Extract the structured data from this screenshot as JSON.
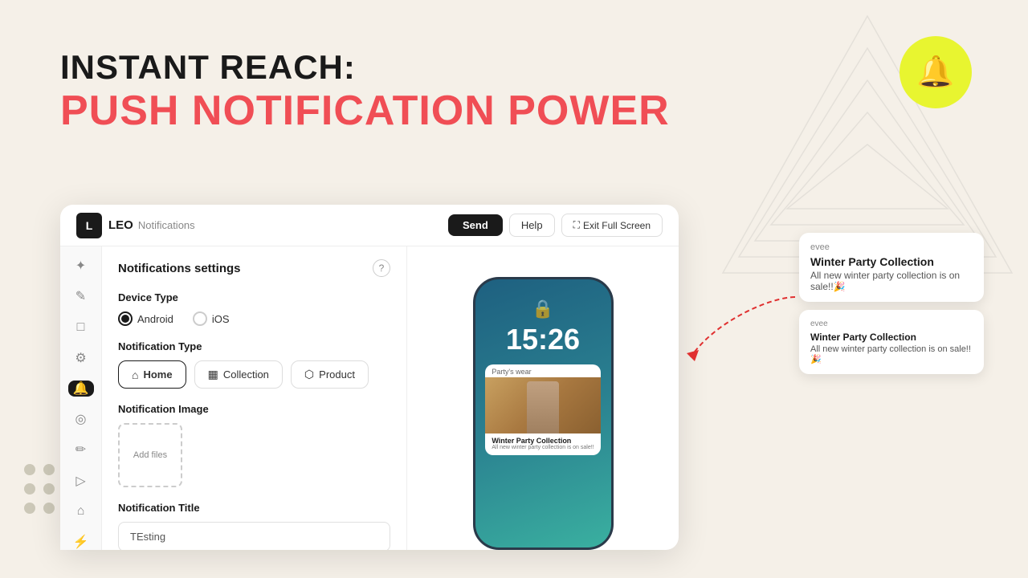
{
  "page": {
    "background_color": "#f5f0e8",
    "header": {
      "line1": "INSTANT REACH:",
      "line2": "PUSH NOTIFICATION POWER"
    },
    "bell_icon": "🔔"
  },
  "app": {
    "logo_text": "L",
    "name": "LEO",
    "subtitle": "Notifications",
    "buttons": {
      "send": "Send",
      "help": "Help",
      "exit": "Exit Full Screen"
    },
    "sidebar_icons": [
      "✦",
      "✎",
      "□",
      "⚙",
      "🔔",
      "◎",
      "✏",
      "▷",
      "⌂",
      "⚡"
    ],
    "settings": {
      "title": "Notifications settings",
      "device_type_label": "Device Type",
      "device_options": [
        "Android",
        "iOS"
      ],
      "device_selected": "Android",
      "notification_type_label": "Notification Type",
      "notification_types": [
        {
          "label": "Home",
          "active": true
        },
        {
          "label": "Collection",
          "active": false
        },
        {
          "label": "Product",
          "active": false
        }
      ],
      "image_label": "Notification Image",
      "add_files_label": "Add files",
      "title_label": "Notification Title",
      "title_value": "TEsting"
    }
  },
  "phone": {
    "time": "15:26",
    "card_label": "Party's wear",
    "card_title": "Winter Party Collection",
    "card_desc": "All new winter party collection is on sale!!"
  },
  "notifications": [
    {
      "app": "evee",
      "title": "Winter Party Collection",
      "desc": "All new winter party collection is on sale!!🎉",
      "size": "large"
    },
    {
      "app": "evee",
      "title": "Winter Party Collection",
      "desc": "All new winter party collection is on sale!!🎉",
      "size": "small"
    }
  ]
}
